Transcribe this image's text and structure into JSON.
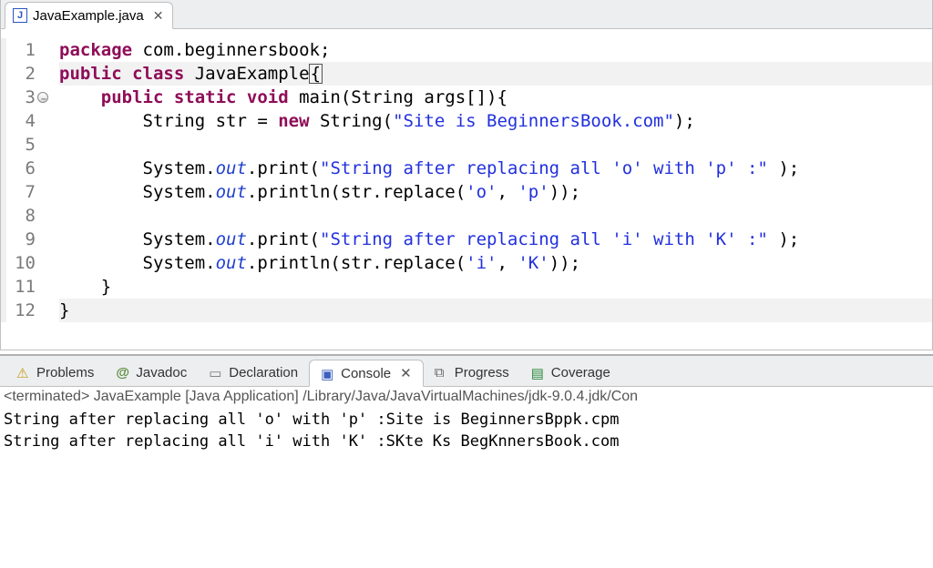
{
  "editor": {
    "tab_title": "JavaExample.java",
    "code": [
      {
        "frags": [
          {
            "t": "package ",
            "c": "kw"
          },
          {
            "t": "com.beginnersbook;",
            "c": "type"
          }
        ]
      },
      {
        "frags": [
          {
            "t": "public class ",
            "c": "kw"
          },
          {
            "t": "JavaExample",
            "c": "type"
          },
          {
            "t": "{",
            "c": "cursor"
          }
        ],
        "hl": true
      },
      {
        "frags": [
          {
            "t": "    ",
            "c": ""
          },
          {
            "t": "public static void ",
            "c": "kw"
          },
          {
            "t": "main(String args[]){",
            "c": "type"
          }
        ],
        "fold": true
      },
      {
        "frags": [
          {
            "t": "        String str = ",
            "c": "type"
          },
          {
            "t": "new ",
            "c": "kw"
          },
          {
            "t": "String(",
            "c": "type"
          },
          {
            "t": "\"Site is BeginnersBook.com\"",
            "c": "str"
          },
          {
            "t": ");",
            "c": "type"
          }
        ]
      },
      {
        "frags": []
      },
      {
        "frags": [
          {
            "t": "        System.",
            "c": "type"
          },
          {
            "t": "out",
            "c": "field"
          },
          {
            "t": ".print(",
            "c": "type"
          },
          {
            "t": "\"String after replacing all 'o' with 'p' :\"",
            "c": "str"
          },
          {
            "t": " );",
            "c": "type"
          }
        ]
      },
      {
        "frags": [
          {
            "t": "        System.",
            "c": "type"
          },
          {
            "t": "out",
            "c": "field"
          },
          {
            "t": ".println(str.replace(",
            "c": "type"
          },
          {
            "t": "'o'",
            "c": "str"
          },
          {
            "t": ", ",
            "c": "type"
          },
          {
            "t": "'p'",
            "c": "str"
          },
          {
            "t": "));",
            "c": "type"
          }
        ]
      },
      {
        "frags": []
      },
      {
        "frags": [
          {
            "t": "        System.",
            "c": "type"
          },
          {
            "t": "out",
            "c": "field"
          },
          {
            "t": ".print(",
            "c": "type"
          },
          {
            "t": "\"String after replacing all 'i' with 'K' :\"",
            "c": "str"
          },
          {
            "t": " );",
            "c": "type"
          }
        ]
      },
      {
        "frags": [
          {
            "t": "        System.",
            "c": "type"
          },
          {
            "t": "out",
            "c": "field"
          },
          {
            "t": ".println(str.replace(",
            "c": "type"
          },
          {
            "t": "'i'",
            "c": "str"
          },
          {
            "t": ", ",
            "c": "type"
          },
          {
            "t": "'K'",
            "c": "str"
          },
          {
            "t": "));",
            "c": "type"
          }
        ]
      },
      {
        "frags": [
          {
            "t": "    }",
            "c": "type"
          }
        ]
      },
      {
        "frags": [
          {
            "t": "}",
            "c": "type"
          }
        ],
        "hl": true
      }
    ]
  },
  "panel": {
    "tabs": {
      "problems": "Problems",
      "javadoc": "Javadoc",
      "declaration": "Declaration",
      "console": "Console",
      "progress": "Progress",
      "coverage": "Coverage"
    },
    "active": "console",
    "console_header": "<terminated> JavaExample [Java Application] /Library/Java/JavaVirtualMachines/jdk-9.0.4.jdk/Con",
    "console_lines": [
      "String after replacing all 'o' with 'p' :Site is BeginnersBppk.cpm",
      "String after replacing all 'i' with 'K' :SKte Ks BegKnnersBook.com"
    ]
  }
}
